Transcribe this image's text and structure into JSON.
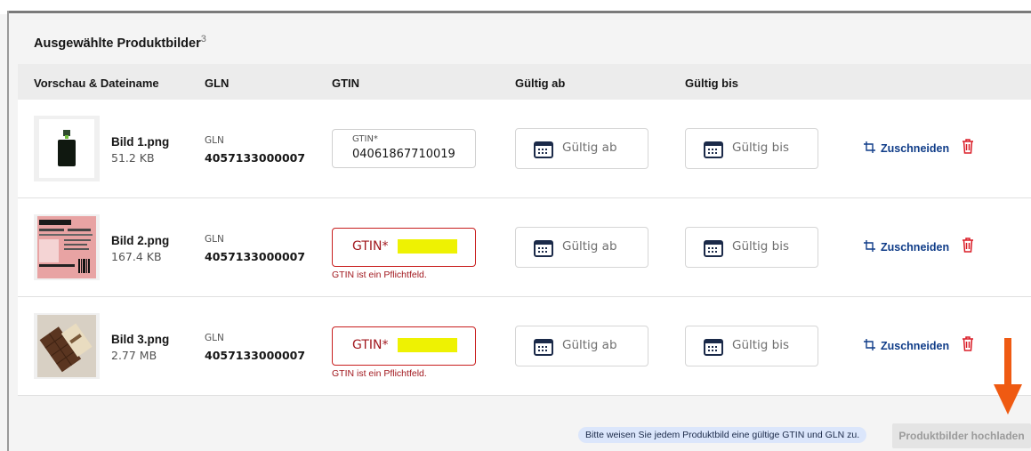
{
  "panel": {
    "title": "Ausgewählte Produktbilder",
    "count": "3"
  },
  "columns": {
    "preview": "Vorschau & Dateiname",
    "gln": "GLN",
    "gtin": "GTIN",
    "valid_from": "Gültig ab",
    "valid_to": "Gültig bis"
  },
  "rows": [
    {
      "filename": "Bild 1.png",
      "size": "51.2 KB",
      "gln_label": "GLN",
      "gln": "4057133000007",
      "gtin_label": "GTIN*",
      "gtin_value": "04061867710019",
      "error": "",
      "valid_from_placeholder": "Gültig ab",
      "valid_to_placeholder": "Gültig bis",
      "crop": "Zuschneiden"
    },
    {
      "filename": "Bild 2.png",
      "size": "167.4 KB",
      "gln_label": "GLN",
      "gln": "4057133000007",
      "gtin_label": "GTIN*",
      "gtin_value": "",
      "error": "GTIN ist ein Pflichtfeld.",
      "valid_from_placeholder": "Gültig ab",
      "valid_to_placeholder": "Gültig bis",
      "crop": "Zuschneiden"
    },
    {
      "filename": "Bild 3.png",
      "size": "2.77 MB",
      "gln_label": "GLN",
      "gln": "4057133000007",
      "gtin_label": "GTIN*",
      "gtin_value": "",
      "error": "GTIN ist ein Pflichtfeld.",
      "valid_from_placeholder": "Gültig ab",
      "valid_to_placeholder": "Gültig bis",
      "crop": "Zuschneiden"
    }
  ],
  "footer": {
    "notice": "Bitte weisen Sie jedem Produktbild eine gültige GTIN und GLN zu.",
    "upload_button": "Produktbilder hochladen"
  },
  "icons": [
    "calendar-icon",
    "crop-icon",
    "trash-icon",
    "arrow-down-icon"
  ],
  "colors": {
    "link": "#0f3c88",
    "error": "#a2191f",
    "trash": "#da1e28",
    "arrow": "#ef5a12",
    "highlight": "#eef202"
  }
}
